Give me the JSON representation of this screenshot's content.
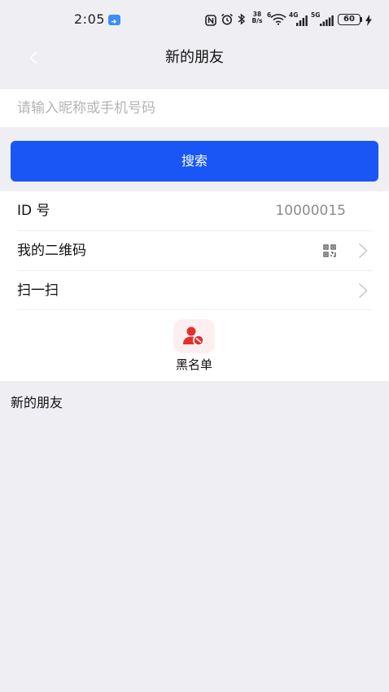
{
  "status_bar": {
    "time": "2:05",
    "speed_value": "38",
    "speed_unit": "B/s",
    "wifi_label": "6",
    "signal_4g_label": "4G",
    "signal_5g_label": "5G",
    "battery": "60"
  },
  "header": {
    "title": "新的朋友",
    "back_icon": "back-chevron-icon"
  },
  "search": {
    "placeholder": "请输入昵称或手机号码",
    "value": "",
    "button_label": "搜索"
  },
  "rows": [
    {
      "label": "ID 号",
      "value": "10000015"
    },
    {
      "label": "我的二维码",
      "icon": "qr-code-icon",
      "trailing_icon": "chevron-right-icon"
    },
    {
      "label": "扫一扫",
      "trailing_icon": "chevron-right-icon"
    }
  ],
  "blacklist": {
    "label": "黑名单",
    "icon": "blacklist-user-icon"
  },
  "new_friends_section": {
    "title": "新的朋友"
  },
  "colors": {
    "accent": "#1a56f6",
    "background": "#efeff3",
    "blacklist_icon": "#e52f2f",
    "blacklist_icon_bg": "#fdefef"
  }
}
